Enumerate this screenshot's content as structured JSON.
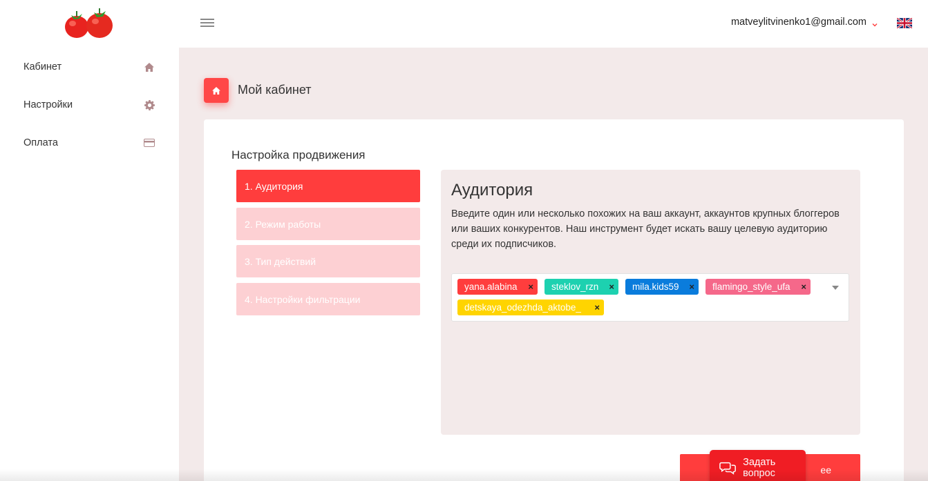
{
  "sidebar": {
    "logo": "tomatoes-logo",
    "items": [
      {
        "label": "Кабинет",
        "icon": "home-icon"
      },
      {
        "label": "Настройки",
        "icon": "gear-icon"
      },
      {
        "label": "Оплата",
        "icon": "credit-card-icon"
      }
    ]
  },
  "header": {
    "user_email": "matveylitvinenko1@gmail.com",
    "language_flag": "uk-flag-icon"
  },
  "page": {
    "title": "Мой кабинет"
  },
  "card": {
    "title": "Настройка продвижения",
    "steps": [
      {
        "label": "1. Аудитория",
        "active": true
      },
      {
        "label": "2. Режим работы",
        "active": false
      },
      {
        "label": "3. Тип действий",
        "active": false
      },
      {
        "label": "4. Настройки фильтрации",
        "active": false
      }
    ],
    "panel": {
      "title": "Аудитория",
      "description": "Введите один или несколько похожих на ваш аккаунт, аккаунтов крупных блоггеров или ваших конкурентов. Наш инструмент будет искать вашу целевую аудиторию среди их подписчиков.",
      "tags": [
        {
          "label": "yana.alabina",
          "color": "#ff3d3d"
        },
        {
          "label": "steklov_rzn",
          "color": "#1dd1b0"
        },
        {
          "label": "mila.kids59",
          "color": "#0a7cdc"
        },
        {
          "label": "flamingo_style_ufa",
          "color": "#f5688a"
        },
        {
          "label": "detskaya_odezhda_aktobe_",
          "color": "#ffd400"
        }
      ],
      "tag_remove_glyph": "×"
    },
    "next_button": "ее"
  },
  "chat": {
    "label": "Задать вопрос",
    "icon": "chat-bubbles-icon"
  },
  "colors": {
    "accent": "#ff3d3d",
    "step_inactive": "#fdd0d3",
    "page_bg": "#f3eaea"
  }
}
